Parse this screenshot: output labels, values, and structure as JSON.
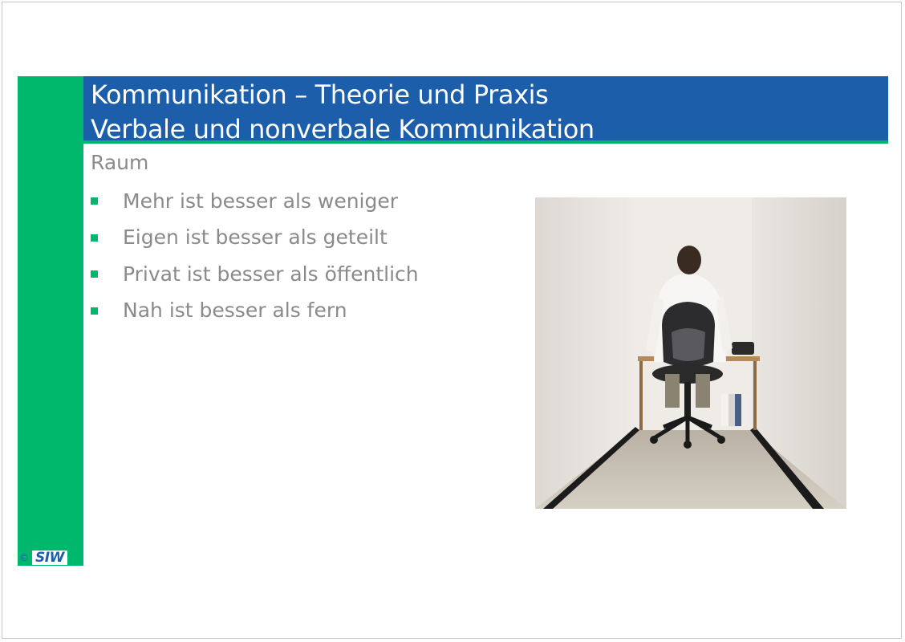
{
  "header": {
    "title_line1": "Kommunikation – Theorie und Praxis",
    "title_line2": "Verbale und nonverbale Kommunikation"
  },
  "content": {
    "subheading": "Raum",
    "bullets": [
      "Mehr ist besser als weniger",
      "Eigen ist besser als geteilt",
      "Privat ist besser als öffentlich",
      "Nah ist besser als fern"
    ]
  },
  "footer": {
    "copyright_symbol": "©",
    "logo_text": "SIW"
  },
  "colors": {
    "accent_green": "#00b86b",
    "title_blue": "#1c5eaa",
    "text_gray": "#8a8a8a"
  },
  "icons": {
    "bullet": "green-square-bullet-icon"
  }
}
